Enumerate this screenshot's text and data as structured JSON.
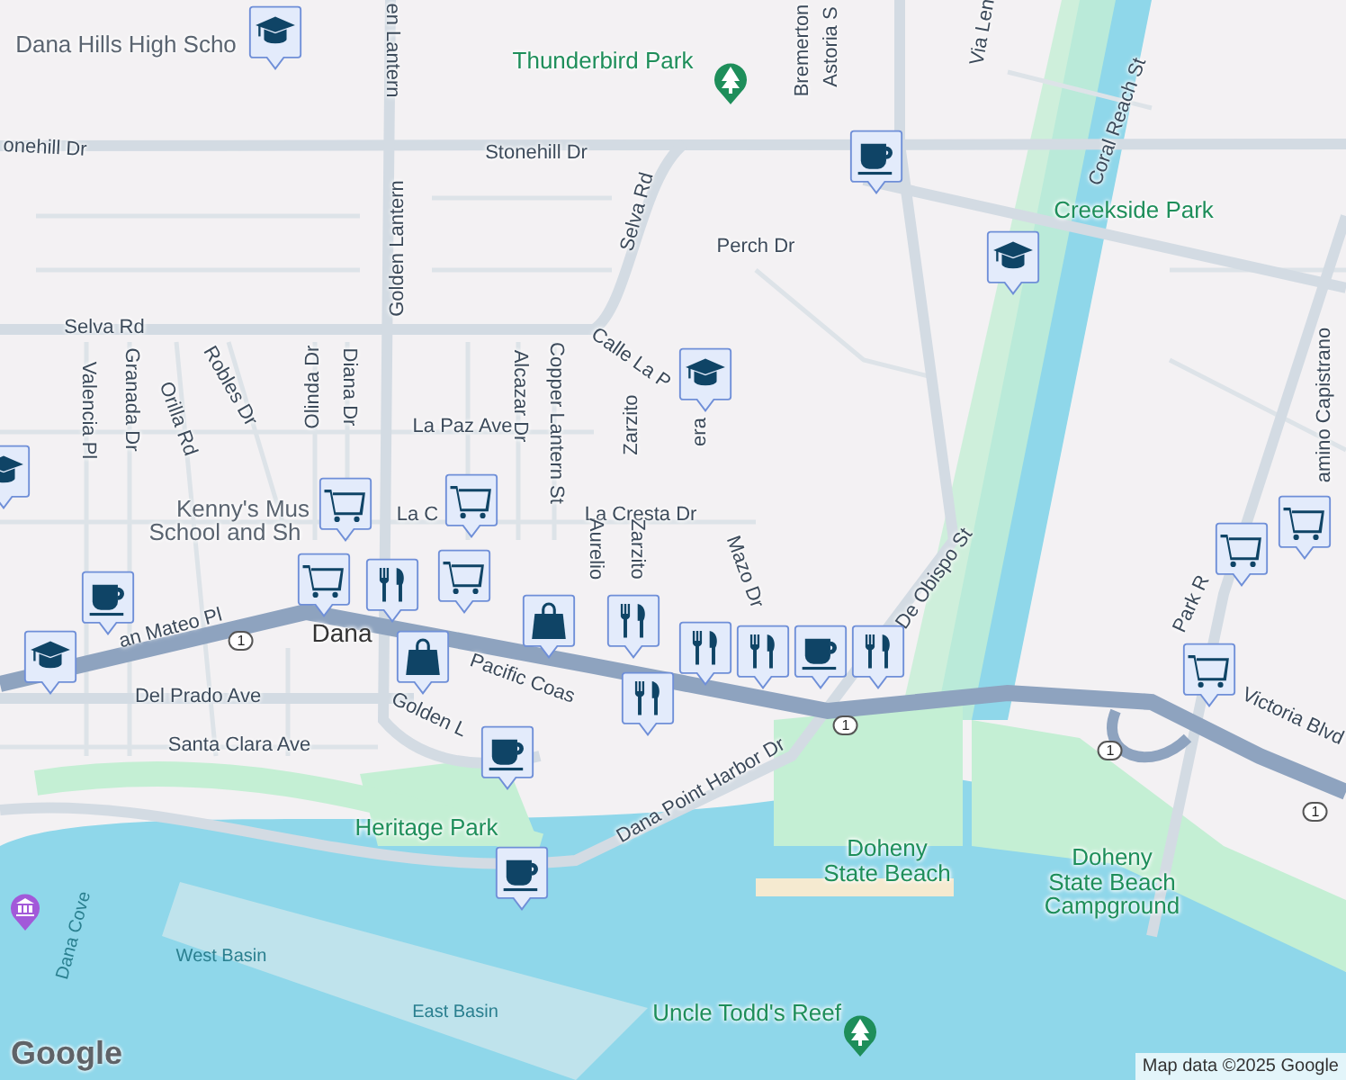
{
  "map": {
    "labels": [
      {
        "text": "Dana Hills High Scho",
        "kind": "place"
      },
      {
        "text": "Thunderbird Park",
        "kind": "park"
      },
      {
        "text": "onehill Dr",
        "kind": "street"
      },
      {
        "text": "Stonehill Dr",
        "kind": "street"
      },
      {
        "text": "en Lantern",
        "kind": "street"
      },
      {
        "text": "Golden Lantern",
        "kind": "street"
      },
      {
        "text": "Selva Rd",
        "kind": "street"
      },
      {
        "text": "Selva Rd",
        "kind": "street"
      },
      {
        "text": "Bremerton",
        "kind": "street"
      },
      {
        "text": "Astoria S",
        "kind": "street"
      },
      {
        "text": "Via Len",
        "kind": "street"
      },
      {
        "text": "Coral Reach St",
        "kind": "street"
      },
      {
        "text": "Creekside Park",
        "kind": "park"
      },
      {
        "text": "Perch Dr",
        "kind": "street"
      },
      {
        "text": "Calle La P",
        "kind": "street"
      },
      {
        "text": "era",
        "kind": "street"
      },
      {
        "text": "Valencia Pl",
        "kind": "street"
      },
      {
        "text": "Granada Dr",
        "kind": "street"
      },
      {
        "text": "Orilla Rd",
        "kind": "street"
      },
      {
        "text": "Robles Dr",
        "kind": "street"
      },
      {
        "text": "Olinda Dr",
        "kind": "street"
      },
      {
        "text": "Diana Dr",
        "kind": "street"
      },
      {
        "text": "La Paz Ave",
        "kind": "street"
      },
      {
        "text": "Alcazar Dr",
        "kind": "street"
      },
      {
        "text": "Copper Lantern St",
        "kind": "street"
      },
      {
        "text": "Zarzito",
        "kind": "street"
      },
      {
        "text": "Kenny's Mus",
        "kind": "place"
      },
      {
        "text": "School and Sh",
        "kind": "place"
      },
      {
        "text": "La C",
        "kind": "street"
      },
      {
        "text": "La Cresta Dr",
        "kind": "street"
      },
      {
        "text": "Mazo Dr",
        "kind": "street"
      },
      {
        "text": "Aurelio",
        "kind": "street"
      },
      {
        "text": "Zarzito",
        "kind": "street"
      },
      {
        "text": "Dana",
        "kind": "town"
      },
      {
        "text": "Pacific Coas",
        "kind": "street"
      },
      {
        "text": "an Mateo Pl",
        "kind": "street"
      },
      {
        "text": "Del Prado Ave",
        "kind": "street"
      },
      {
        "text": "Santa Clara Ave",
        "kind": "street"
      },
      {
        "text": "Golden L",
        "kind": "street"
      },
      {
        "text": "Heritage Park",
        "kind": "park"
      },
      {
        "text": "Dana Point Harbor Dr",
        "kind": "street"
      },
      {
        "text": "De Obispo St",
        "kind": "street"
      },
      {
        "text": "Doheny\nState Beach",
        "kind": "park"
      },
      {
        "text": "Doheny\nState Beach\nCampground",
        "kind": "park"
      },
      {
        "text": "Uncle Todd's Reef",
        "kind": "park"
      },
      {
        "text": "West Basin",
        "kind": "water"
      },
      {
        "text": "East Basin",
        "kind": "water"
      },
      {
        "text": "Dana Cove",
        "kind": "water"
      },
      {
        "text": "Victoria Blvd",
        "kind": "street"
      },
      {
        "text": "Park R",
        "kind": "street"
      },
      {
        "text": "amino Capistrano",
        "kind": "street"
      }
    ],
    "shields": [
      "1",
      "1",
      "1",
      "1"
    ],
    "markers": [
      {
        "kind": "school"
      },
      {
        "kind": "school"
      },
      {
        "kind": "school"
      },
      {
        "kind": "school"
      },
      {
        "kind": "school"
      },
      {
        "kind": "cafe"
      },
      {
        "kind": "cafe"
      },
      {
        "kind": "cafe"
      },
      {
        "kind": "cafe"
      },
      {
        "kind": "cafe"
      },
      {
        "kind": "shop"
      },
      {
        "kind": "shop"
      },
      {
        "kind": "shop"
      },
      {
        "kind": "shop"
      },
      {
        "kind": "shop"
      },
      {
        "kind": "shop"
      },
      {
        "kind": "shop"
      },
      {
        "kind": "restaurant"
      },
      {
        "kind": "restaurant"
      },
      {
        "kind": "restaurant"
      },
      {
        "kind": "restaurant"
      },
      {
        "kind": "restaurant"
      },
      {
        "kind": "restaurant"
      },
      {
        "kind": "bag"
      },
      {
        "kind": "bag"
      }
    ],
    "places": [
      {
        "kind": "park"
      },
      {
        "kind": "park"
      },
      {
        "kind": "museum"
      }
    ],
    "logo": "Google",
    "attribution": "Map data ©2025 Google"
  }
}
